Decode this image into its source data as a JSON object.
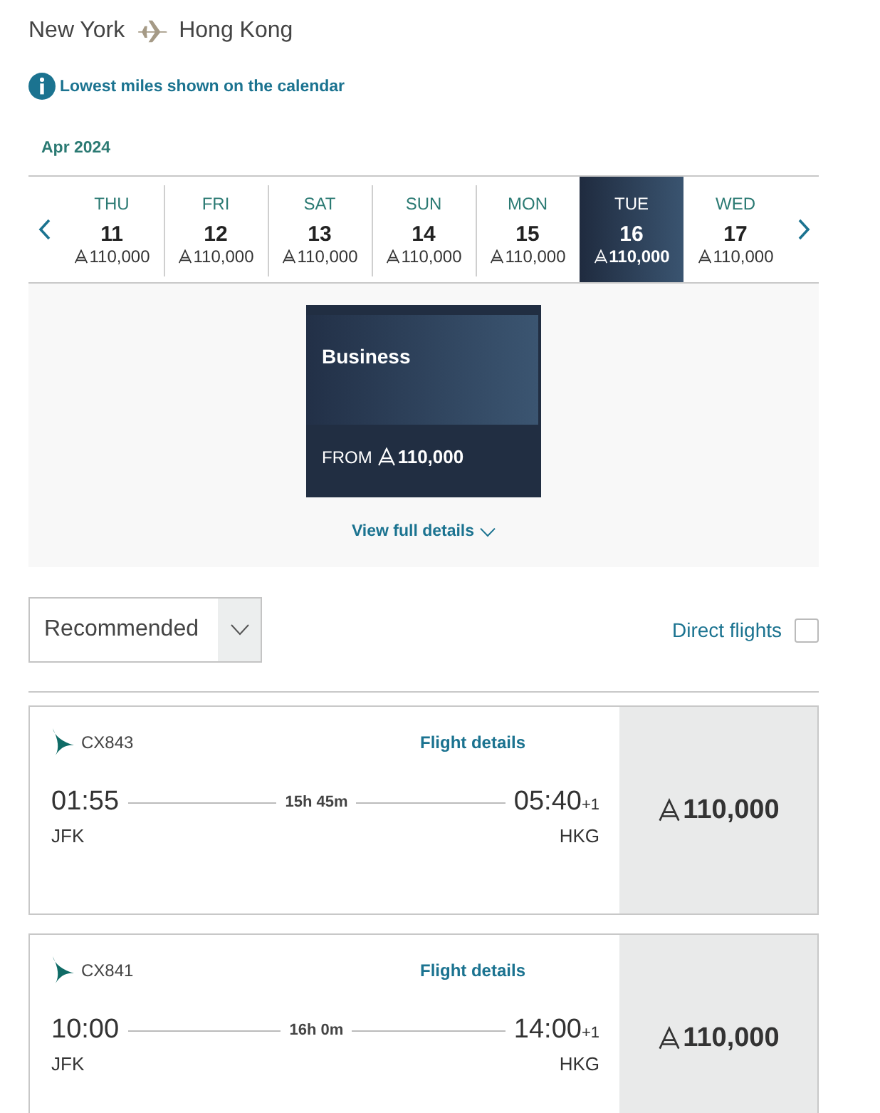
{
  "route": {
    "origin": "New York",
    "destination": "Hong Kong"
  },
  "notice": "Lowest miles shown on the calendar",
  "month": "Apr 2024",
  "days": [
    {
      "weekday": "THU",
      "date": "11",
      "miles": "110,000",
      "selected": false
    },
    {
      "weekday": "FRI",
      "date": "12",
      "miles": "110,000",
      "selected": false
    },
    {
      "weekday": "SAT",
      "date": "13",
      "miles": "110,000",
      "selected": false
    },
    {
      "weekday": "SUN",
      "date": "14",
      "miles": "110,000",
      "selected": false
    },
    {
      "weekday": "MON",
      "date": "15",
      "miles": "110,000",
      "selected": false
    },
    {
      "weekday": "TUE",
      "date": "16",
      "miles": "110,000",
      "selected": true
    },
    {
      "weekday": "WED",
      "date": "17",
      "miles": "110,000",
      "selected": false
    }
  ],
  "cabin": {
    "name": "Business",
    "from_label": "FROM",
    "miles": "110,000"
  },
  "details_link": "View full details",
  "sort": {
    "value": "Recommended"
  },
  "direct_filter": {
    "label": "Direct flights",
    "checked": false
  },
  "flights": [
    {
      "number": "CX843",
      "details": "Flight details",
      "depart": "01:55",
      "from": "JFK",
      "duration": "15h 45m",
      "arrive": "05:40",
      "day_offset": "+1",
      "to": "HKG",
      "miles": "110,000"
    },
    {
      "number": "CX841",
      "details": "Flight details",
      "depart": "10:00",
      "from": "JFK",
      "duration": "16h 0m",
      "arrive": "14:00",
      "day_offset": "+1",
      "to": "HKG",
      "miles": "110,000"
    }
  ]
}
